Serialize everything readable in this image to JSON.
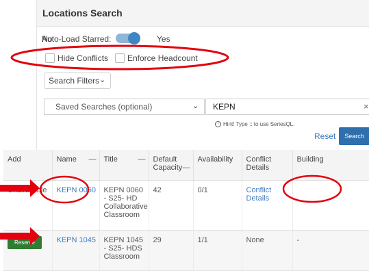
{
  "panel": {
    "title": "Locations Search"
  },
  "autoload": {
    "label": "Auto-Load Starred:",
    "off_label": "No",
    "on_label": "Yes"
  },
  "checkboxes": {
    "hide_conflicts": "Hide Conflicts",
    "enforce_headcount": "Enforce Headcount"
  },
  "filters": {
    "label": "Search Filters"
  },
  "saved_searches": {
    "placeholder": "Saved Searches (optional)"
  },
  "search": {
    "value": "KEPN",
    "hint": "Hint! Type :: to use SeriesQL.",
    "hint_icon": "info-icon"
  },
  "actions": {
    "reset": "Reset",
    "search": "Search"
  },
  "table": {
    "headers": [
      "Add",
      "Name",
      "Title",
      "Default Capacity",
      "Availability",
      "Conflict Details",
      "Building"
    ],
    "rows": [
      {
        "add": "Unavailable",
        "name": "KEPN 0060",
        "title": "KEPN 0060 - S25- HD Collaborative Classroom",
        "capacity": "42",
        "availability": "0/1",
        "conflict": "Conflict Details",
        "building": ""
      },
      {
        "add": "Reserve",
        "name": "KEPN 1045",
        "title": "KEPN 1045 - S25- HDS Classroom",
        "capacity": "29",
        "availability": "1/1",
        "conflict": "None",
        "building": "-"
      }
    ]
  },
  "colors": {
    "annotation": "#e3000f",
    "accent": "#2f6fad",
    "reserve": "#2e7d32",
    "link": "#3c7bc0"
  }
}
